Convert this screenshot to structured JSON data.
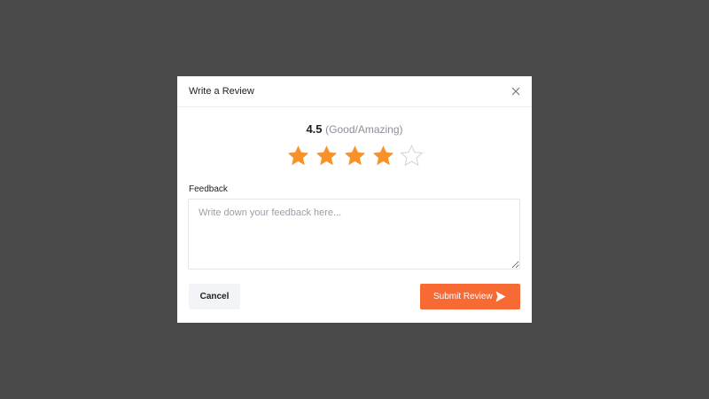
{
  "modal": {
    "title": "Write a Review"
  },
  "rating": {
    "value": "4.5",
    "description": "(Good/Amazing)",
    "stars_filled": 4,
    "stars_total": 5
  },
  "feedback": {
    "label": "Feedback",
    "placeholder": "Write down your feedback here...",
    "value": ""
  },
  "actions": {
    "cancel_label": "Cancel",
    "submit_label": "Submit Review"
  },
  "colors": {
    "overlay": "#4a4a4a",
    "star_filled": "#f7922b",
    "star_empty_outline": "#cfd3d8",
    "submit_background": "#f86a34",
    "cancel_background": "#f3f4f7"
  },
  "icons": {
    "close": "close-icon",
    "star": "star-icon",
    "send": "send-icon"
  }
}
